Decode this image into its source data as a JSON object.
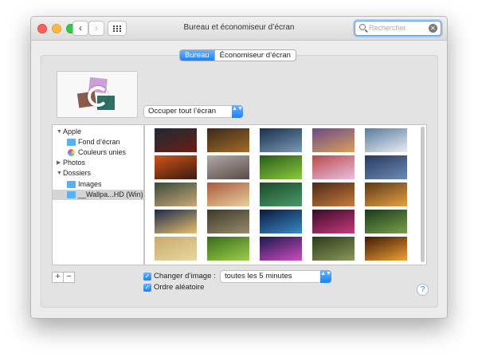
{
  "window": {
    "title": "Bureau et économiseur d’écran",
    "search_placeholder": "Rechercher",
    "back_glyph": "‹",
    "forward_glyph": "›",
    "clear_glyph": "✕"
  },
  "tabs": [
    {
      "label": "Bureau",
      "active": true
    },
    {
      "label": "Économiseur d’écran",
      "active": false
    }
  ],
  "fill_mode": {
    "selected": "Occuper tout l’écran",
    "arrow": "▲▼"
  },
  "sidebar": {
    "apple": {
      "label": "Apple",
      "expanded": true,
      "tri": "▼"
    },
    "fond": {
      "label": "Fond d’écran",
      "icon": "folder-icon"
    },
    "couleurs": {
      "label": "Couleurs unies",
      "icon": "color-wheel-icon"
    },
    "photos": {
      "label": "Photos",
      "expanded": false,
      "tri": "▶"
    },
    "dossiers": {
      "label": "Dossiers",
      "expanded": true,
      "tri": "▼"
    },
    "images": {
      "label": "Images",
      "icon": "folder-icon"
    },
    "wallpa": {
      "label": "__Wallpa...HD (Win)",
      "icon": "folder-icon",
      "selected": true
    }
  },
  "gallery": {
    "thumbnails": [
      {
        "colors": [
          "#1c2a35",
          "#6b1f12"
        ]
      },
      {
        "colors": [
          "#3a2a18",
          "#a56a2a"
        ]
      },
      {
        "colors": [
          "#1a3048",
          "#7a9ab8"
        ]
      },
      {
        "colors": [
          "#6a4a8a",
          "#d9a05a"
        ]
      },
      {
        "colors": [
          "#5a7a9a",
          "#e8eef4"
        ]
      },
      {
        "colors": [
          "#d0541a",
          "#3a1a10"
        ]
      },
      {
        "colors": [
          "#b0aaa8",
          "#5a4a48"
        ]
      },
      {
        "colors": [
          "#2a5a1a",
          "#8acb3a"
        ]
      },
      {
        "colors": [
          "#b84a4a",
          "#e8c0e0"
        ]
      },
      {
        "colors": [
          "#2a3a5a",
          "#6a8ab8"
        ]
      },
      {
        "colors": [
          "#3a4a3a",
          "#c8a878"
        ]
      },
      {
        "colors": [
          "#aa5a3a",
          "#e8d0a0"
        ]
      },
      {
        "colors": [
          "#1a4a2a",
          "#4a9a6a"
        ]
      },
      {
        "colors": [
          "#4a2a1a",
          "#c87a3a"
        ]
      },
      {
        "colors": [
          "#5a3a1a",
          "#e8a040"
        ]
      },
      {
        "colors": [
          "#1a2a4a",
          "#e8c070"
        ]
      },
      {
        "colors": [
          "#3a3a2a",
          "#9a8a6a"
        ]
      },
      {
        "colors": [
          "#0a1a3a",
          "#3a8ac8"
        ]
      },
      {
        "colors": [
          "#3a0a2a",
          "#c83a7a"
        ]
      },
      {
        "colors": [
          "#1a3a1a",
          "#7aa04a"
        ]
      },
      {
        "colors": [
          "#c8aa6a",
          "#e8d8a0"
        ]
      },
      {
        "colors": [
          "#3a6a1a",
          "#9ad04a"
        ]
      },
      {
        "colors": [
          "#1a1a4a",
          "#d04ac0"
        ]
      },
      {
        "colors": [
          "#2a3a1a",
          "#8a9a5a"
        ]
      },
      {
        "colors": [
          "#3a1a0a",
          "#f0a030"
        ]
      }
    ]
  },
  "controls": {
    "plus": "+",
    "minus": "−",
    "change_checked": true,
    "change_label": "Changer d’image :",
    "interval": "toutes les 5 minutes",
    "random_checked": true,
    "random_label": "Ordre aléatoire",
    "check_glyph": "✓",
    "help": "?"
  },
  "colors": {
    "accent": "#1a82fb"
  }
}
